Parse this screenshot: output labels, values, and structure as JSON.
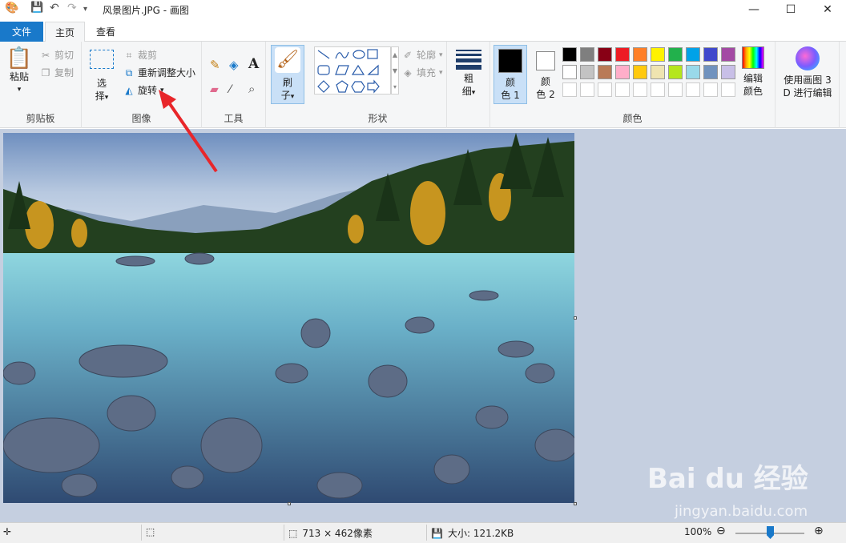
{
  "window": {
    "title": "风景图片.JPG - 画图",
    "minimize": "—",
    "maximize": "☐",
    "close": "✕"
  },
  "tabs": {
    "file": "文件",
    "home": "主页",
    "view": "查看"
  },
  "clipboard": {
    "paste": "粘贴",
    "cut": "剪切",
    "copy": "复制",
    "group": "剪贴板"
  },
  "image": {
    "select_l1": "选",
    "select_l2": "择",
    "crop": "裁剪",
    "resize": "重新调整大小",
    "rotate": "旋转",
    "group": "图像"
  },
  "tools": {
    "group": "工具"
  },
  "brush": {
    "l1": "刷",
    "l2": "子"
  },
  "shapes": {
    "outline": "轮廓",
    "fill": "填充",
    "group": "形状"
  },
  "size": {
    "l1": "粗",
    "l2": "细"
  },
  "colors": {
    "color1_l1": "颜",
    "color1_l2": "色 1",
    "color2_l1": "颜",
    "color2_l2": "色 2",
    "edit_l1": "编辑",
    "edit_l2": "颜色",
    "group": "颜色",
    "palette": [
      "#000000",
      "#7f7f7f",
      "#880015",
      "#ed1c24",
      "#ff7f27",
      "#fff200",
      "#22b14c",
      "#00a2e8",
      "#3f48cc",
      "#a349a4",
      "#ffffff",
      "#c3c3c3",
      "#b97a57",
      "#ffaec9",
      "#ffc90e",
      "#efe4b0",
      "#b5e61d",
      "#99d9ea",
      "#7092be",
      "#c8bfe7"
    ]
  },
  "paint3d": {
    "l1": "使用画图 3",
    "l2": "D 进行编辑"
  },
  "status": {
    "dimensions": "713 × 462像素",
    "filesize": "大小: 121.2KB",
    "zoom": "100%"
  },
  "watermark": {
    "brand": "Bai du 经验",
    "url": "jingyan.baidu.com"
  }
}
